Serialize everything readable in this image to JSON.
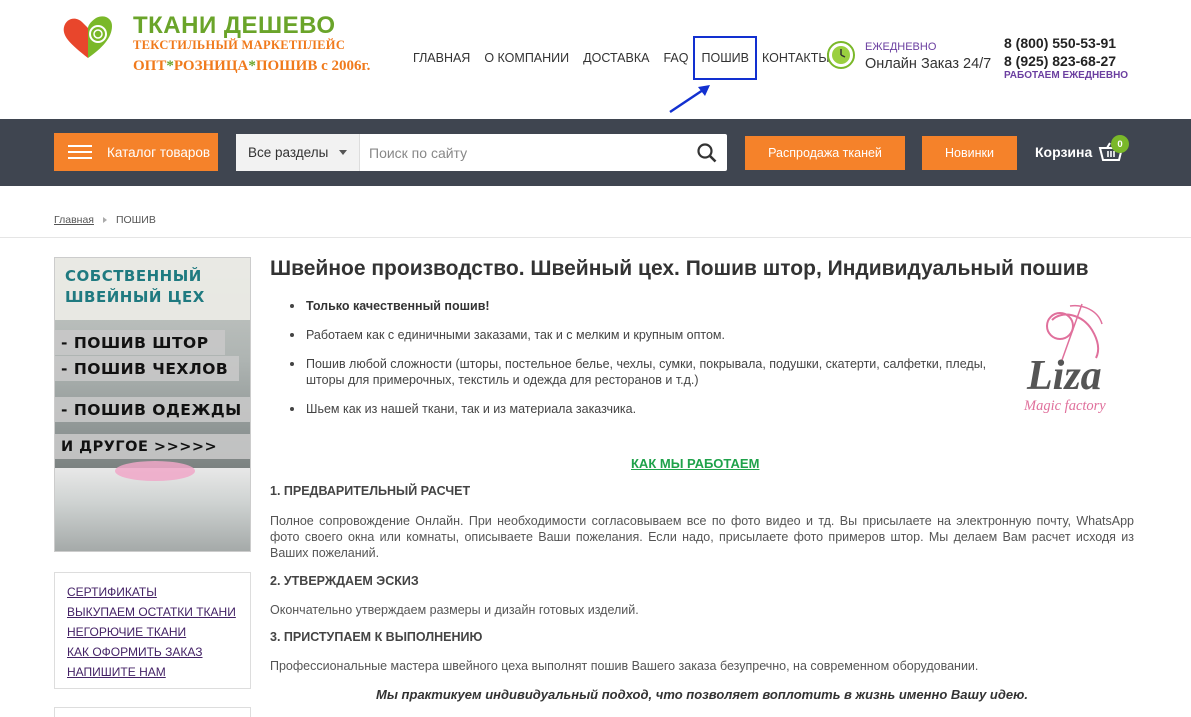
{
  "header": {
    "logo_title": "ТКАНИ ДЕШЕВО",
    "logo_subtitle": "ТЕКСТИЛЬНЫЙ МАРКЕТПЛЕЙС",
    "logo_slogan": {
      "opt": "ОПТ",
      "roz": "РОЗНИЦА",
      "posh": "ПОШИВ с 2006г.",
      "star": "*"
    },
    "nav": [
      {
        "label": "ГЛАВНАЯ"
      },
      {
        "label": "О КОМПАНИИ"
      },
      {
        "label": "ДОСТАВКА"
      },
      {
        "label": "FAQ"
      },
      {
        "label": "ПОШИВ"
      },
      {
        "label": "КОНТАКТЫ"
      }
    ],
    "daily_label": "ЕЖЕДНЕВНО",
    "daily_text": "Онлайн Заказ 24/7",
    "phone1": "8 (800) 550-53-91",
    "phone2": "8 (925) 823-68-27",
    "work_label": "РАБОТАЕМ ЕЖЕДНЕВНО"
  },
  "toolbar": {
    "catalog_label": "Каталог товаров",
    "search_section": "Все разделы",
    "search_placeholder": "Поиск по сайту",
    "sale_label": "Распродажа тканей",
    "new_label": "Новинки",
    "cart_label": "Корзина",
    "cart_count": "0"
  },
  "breadcrumb": {
    "home": "Главная",
    "current": "ПОШИВ"
  },
  "banner": {
    "title1": "СОБСТВЕННЫЙ",
    "title2": "ШВЕЙНЫЙ ЦЕХ",
    "line1": "- ПОШИВ ШТОР",
    "line2": "- ПОШИВ ЧЕХЛОВ",
    "line3": "- ПОШИВ ОДЕЖДЫ",
    "line4": "И ДРУГОЕ >>>>>"
  },
  "leftmenu": [
    {
      "label": "СЕРТИФИКАТЫ"
    },
    {
      "label": "ВЫКУПАЕМ ОСТАТКИ ТКАНИ"
    },
    {
      "label": "НЕГОРЮЧИЕ ТКАНИ"
    },
    {
      "label": "КАК ОФОРМИТЬ ЗАКАЗ"
    },
    {
      "label": "НАПИШИТЕ НАМ"
    }
  ],
  "main": {
    "title": "Швейное производство. Швейный цех. Пошив штор, Индивидуальный пошив",
    "bullets": [
      "Только качественный пошив!",
      "Работаем как с единичными заказами, так и с мелким и крупным оптом.",
      "Пошив любой сложности (шторы, постельное белье, чехлы, сумки, покрывала, подушки, скатерти, салфетки, пледы, шторы для примерочных, текстиль и одежда для ресторанов и т.д.)",
      "Шьем как из нашей ткани, так и из материала заказчика."
    ],
    "liza_name": "Liza",
    "liza_sub": "Magic factory",
    "how_title": "КАК МЫ РАБОТАЕМ",
    "steps": [
      {
        "heading": "1. ПРЕДВАРИТЕЛЬНЫЙ РАСЧЕТ",
        "text": "Полное сопровождение Онлайн. При необходимости согласовываем все по фото видео и тд. Вы присылаете на электронную почту, WhatsApp фото своего окна или комнаты, описываете Ваши пожелания. Если надо, присылаете фото примеров штор. Мы делаем Вам расчет исходя из Ваших пожеланий."
      },
      {
        "heading": "2. УТВЕРЖДАЕМ ЭСКИЗ",
        "text": "Окончательно утверждаем размеры и дизайн готовых изделий."
      },
      {
        "heading": "3. ПРИСТУПАЕМ К ВЫПОЛНЕНИЮ",
        "text": "Профессиональные мастера швейного цеха выполнят пошив Вашего заказа безупречно, на современном оборудовании."
      }
    ],
    "motto": "Мы практикуем индивидуальный подход, что позволяет воплотить в жизнь именно Вашу идею."
  },
  "colors": {
    "brand_green": "#6aa42a",
    "brand_orange": "#f5822a",
    "dark_bar": "#3f4550",
    "highlight": "#1230d0"
  }
}
